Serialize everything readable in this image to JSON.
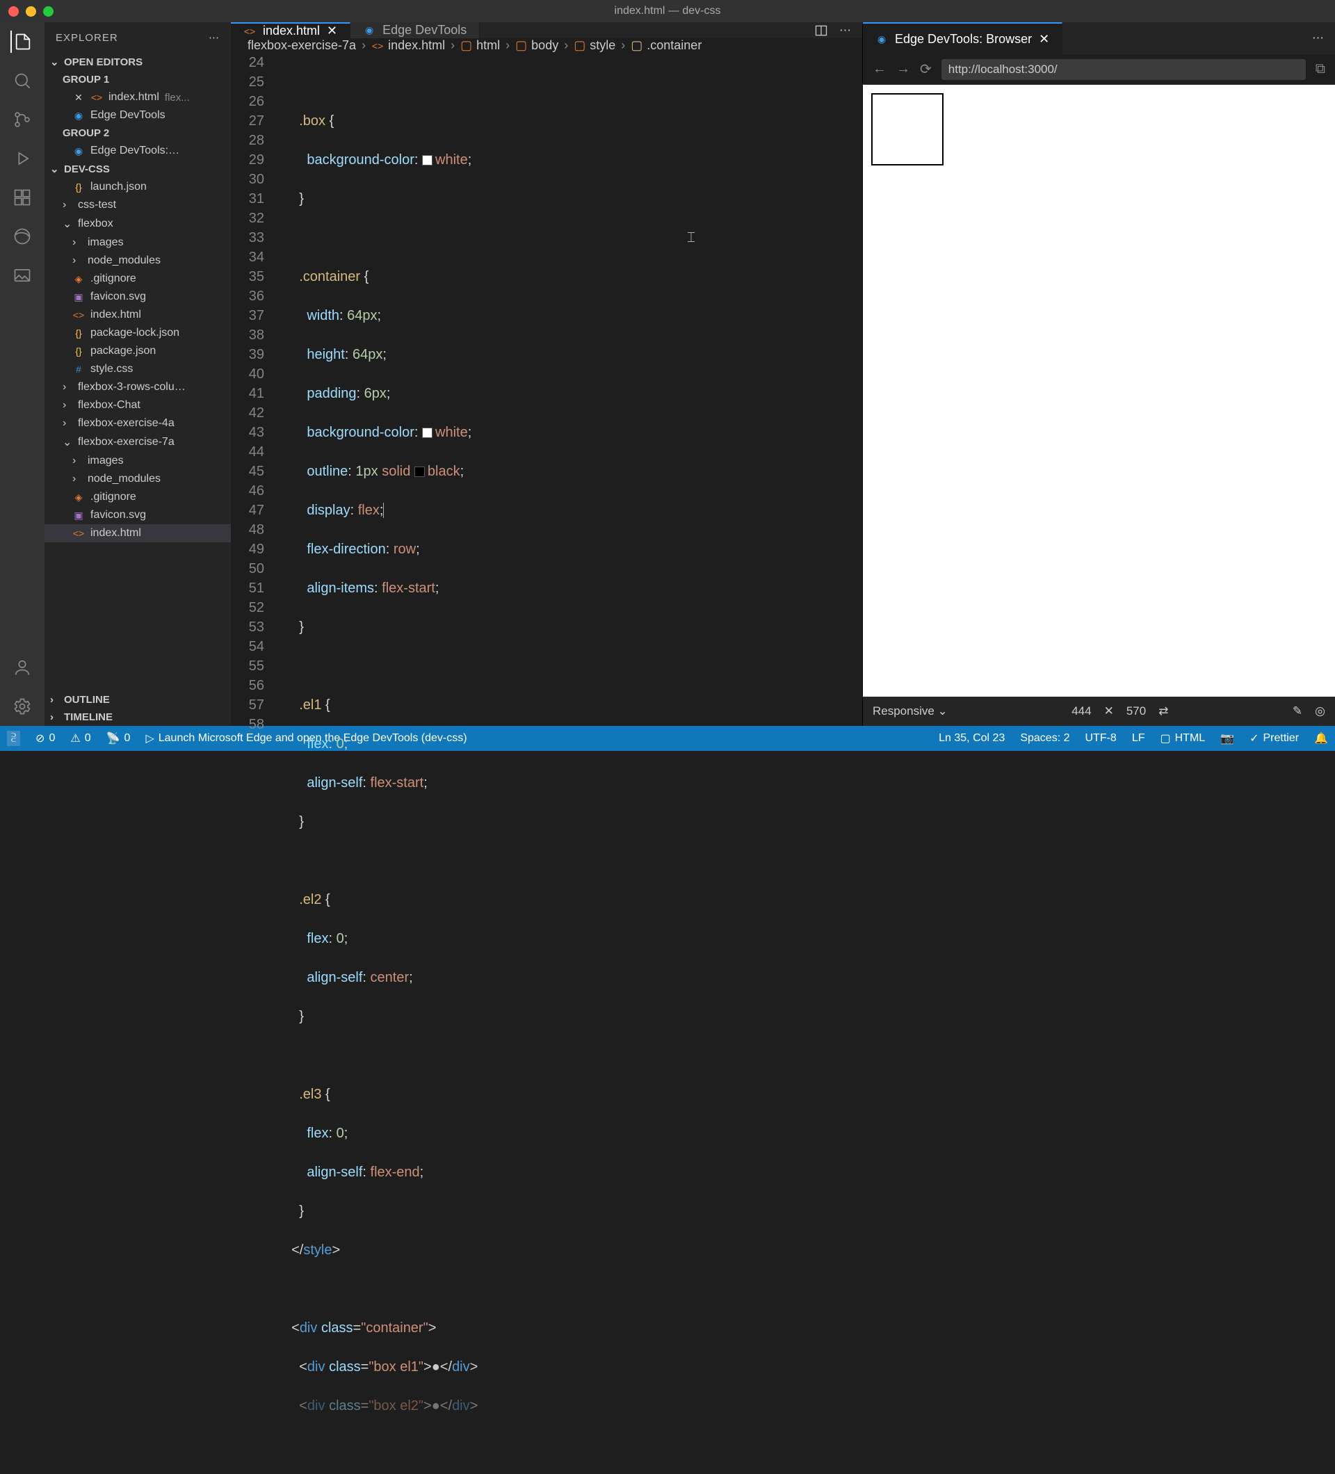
{
  "window_title": "index.html — dev-css",
  "sidebar": {
    "title": "EXPLORER",
    "open_editors_label": "OPEN EDITORS",
    "group1": "GROUP 1",
    "group2": "GROUP 2",
    "oe_index": "index.html",
    "oe_index_desc": "flex...",
    "oe_edge": "Edge DevTools",
    "oe_edge2": "Edge DevTools:…",
    "workspace": "DEV-CSS",
    "tree": {
      "launch": "launch.json",
      "csstest": "css-test",
      "flexbox": "flexbox",
      "images": "images",
      "node_modules": "node_modules",
      "gitignore": ".gitignore",
      "favicon": "favicon.svg",
      "indexhtml": "index.html",
      "pkglock": "package-lock.json",
      "pkg": "package.json",
      "style": "style.css",
      "fb3": "flexbox-3-rows-colu…",
      "fbchat": "flexbox-Chat",
      "fb4a": "flexbox-exercise-4a",
      "fb7a": "flexbox-exercise-7a",
      "images2": "images",
      "node2": "node_modules",
      "gitignore2": ".gitignore",
      "favicon2": "favicon.svg",
      "indexhtml2": "index.html"
    },
    "outline": "OUTLINE",
    "timeline": "TIMELINE"
  },
  "tabs": {
    "index": "index.html",
    "edge": "Edge DevTools",
    "edge_browser": "Edge DevTools: Browser"
  },
  "breadcrumb": {
    "p1": "flexbox-exercise-7a",
    "p2": "index.html",
    "p3": "html",
    "p4": "body",
    "p5": "style",
    "p6": ".container"
  },
  "code": {
    "lines": [
      "24",
      "25",
      "26",
      "27",
      "28",
      "29",
      "30",
      "31",
      "32",
      "33",
      "34",
      "35",
      "36",
      "37",
      "38",
      "39",
      "40",
      "41",
      "42",
      "43",
      "44",
      "45",
      "46",
      "47",
      "48",
      "49",
      "50",
      "51",
      "52",
      "53",
      "54",
      "55",
      "56",
      "57",
      "58"
    ]
  },
  "devtools": {
    "url": "http://localhost:3000/",
    "responsive": "Responsive",
    "w": "444",
    "h": "570"
  },
  "status": {
    "errors": "0",
    "warnings": "0",
    "port": "0",
    "launch": "Launch Microsoft Edge and open the Edge DevTools (dev-css)",
    "lncol": "Ln 35, Col 23",
    "spaces": "Spaces: 2",
    "enc": "UTF-8",
    "eol": "LF",
    "lang": "HTML",
    "prettier": "Prettier"
  }
}
